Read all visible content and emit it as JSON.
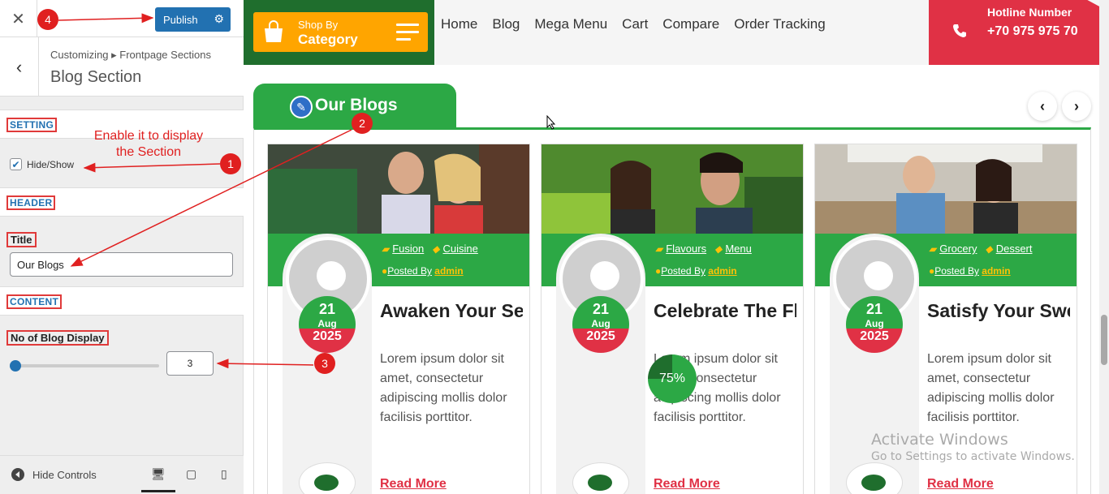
{
  "customizer": {
    "publish_label": "Publish",
    "breadcrumb": "Customizing ▸ Frontpage Sections",
    "section_title": "Blog Section",
    "setting_label": "SETTING",
    "hideshow_label": "Hide/Show",
    "header_label": "HEADER",
    "title_label": "Title",
    "title_value": "Our Blogs",
    "content_label": "CONTENT",
    "blog_count_label": "No of Blog Display",
    "blog_count_value": "3",
    "blog_count_fraction": 0.0,
    "hide_controls_label": "Hide Controls"
  },
  "annotations": {
    "instruction": "Enable it to display the Section",
    "markers": [
      "1",
      "2",
      "3",
      "4"
    ]
  },
  "site": {
    "shop_line1": "Shop By",
    "shop_line2": "Category",
    "nav": [
      "Home",
      "Blog",
      "Mega Menu",
      "Cart",
      "Compare",
      "Order Tracking"
    ],
    "hotline_label": "Hotline Number",
    "hotline_number": "+70 975 975 70",
    "blog_heading": "Our Blogs",
    "progress_label": "75%",
    "progress_value": 75,
    "watermark_line1": "Activate Windows",
    "watermark_line2": "Go to Settings to activate Windows.",
    "cards": [
      {
        "cat1": "Fusion",
        "cat2": "Cuisine",
        "posted_by": "Posted By",
        "author": "admin",
        "day": "21",
        "month": "Aug",
        "year": "2025",
        "title": "Awaken Your Senses With…",
        "excerpt": "Lorem ipsum dolor sit amet, consectetur adipiscing mollis dolor facilisis porttitor.",
        "read_more": "Read More"
      },
      {
        "cat1": "Flavours",
        "cat2": "Menu",
        "posted_by": "Posted By",
        "author": "admin",
        "day": "21",
        "month": "Aug",
        "year": "2025",
        "title": "Celebrate The Flavors…",
        "excerpt": "Lorem ipsum dolor sit amet, consectetur adipiscing mollis dolor facilisis porttitor.",
        "read_more": "Read More"
      },
      {
        "cat1": "Grocery",
        "cat2": "Dessert",
        "posted_by": "Posted By",
        "author": "admin",
        "day": "21",
        "month": "Aug",
        "year": "2025",
        "title": "Satisfy Your Sweet Tooth…",
        "excerpt": "Lorem ipsum dolor sit amet, consectetur adipiscing mollis dolor facilisis porttitor.",
        "read_more": "Read More"
      }
    ]
  },
  "colors": {
    "accent_blue": "#2271b1",
    "brand_green": "#2ca845",
    "dark_green": "#1f6e2d",
    "brand_red": "#e03145",
    "orange": "#ffa500",
    "annotation_red": "#e02020"
  }
}
